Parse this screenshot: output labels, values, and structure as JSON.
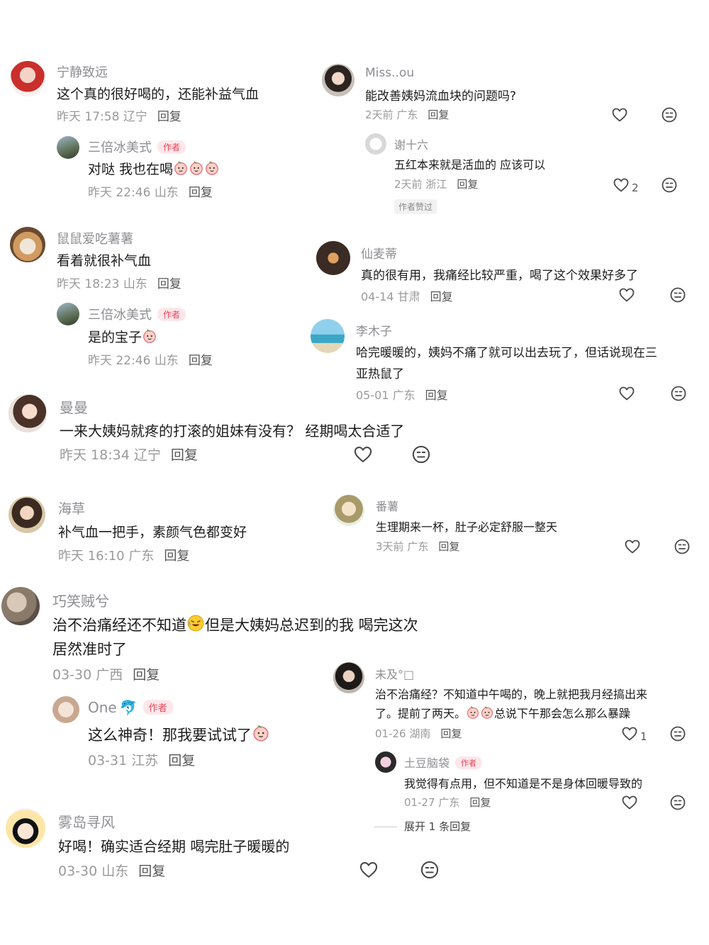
{
  "author_badge": "作者",
  "reply_label": "回复",
  "left": [
    {
      "name": "宁静致远",
      "text": "这个真的很好喝的，还能补益气血",
      "date": "昨天 17:58",
      "loc": "辽宁"
    },
    {
      "name": "三倍冰美式",
      "text": "对哒 我也在喝",
      "date": "昨天 22:46",
      "loc": "山东"
    },
    {
      "name": "鼠鼠爱吃薯薯",
      "text": "看着就很补气血",
      "date": "昨天 18:23",
      "loc": "山东"
    },
    {
      "name": "三倍冰美式",
      "text": "是的宝子",
      "date": "昨天 22:46",
      "loc": "山东"
    },
    {
      "name": "曼曼",
      "text": "一来大姨妈就疼的打滚的姐妹有没有？ 经期喝太合适了",
      "date": "昨天 18:34",
      "loc": "辽宁"
    },
    {
      "name": "海草",
      "text": "补气血一把手，素颜气色都变好",
      "date": "昨天 16:10",
      "loc": "广东"
    },
    {
      "name": "巧笑贼兮",
      "text1": "治不治痛经还不知道",
      "text2": "但是大姨妈总迟到的我  喝完这次",
      "text3": "居然准时了",
      "date": "03-30",
      "loc": "广西"
    },
    {
      "name": "One",
      "text": "这么神奇！那我要试试了",
      "date": "03-31",
      "loc": "江苏"
    },
    {
      "name": "雾岛寻风",
      "text": "好喝！确实适合经期 喝完肚子暖暖的",
      "date": "03-30",
      "loc": "山东"
    }
  ],
  "right": [
    {
      "name": "Miss..ou",
      "text": "能改善姨妈流血块的问题吗?",
      "date": "2天前",
      "loc": "广东"
    },
    {
      "name": "谢十六",
      "text": "五红本来就是活血的 应该可以",
      "date": "2天前",
      "loc": "浙江",
      "likes": "2",
      "tag": "作者赞过"
    },
    {
      "name": "仙麦蒂",
      "text": "真的很有用，我痛经比较严重，喝了这个效果好多了",
      "date": "04-14",
      "loc": "甘肃"
    },
    {
      "name": "李木子",
      "text1": "哈完暖暖的，姨妈不痛了就可以出去玩了，但话说现在三",
      "text2": "亚热鼠了",
      "date": "05-01",
      "loc": "广东"
    },
    {
      "name": "番薯",
      "text": "生理期来一杯，肚子必定舒服一整天",
      "date": "3天前",
      "loc": "广东"
    },
    {
      "name": "未及°□",
      "text1": "治不治痛经？不知道中午喝的，晚上就把我月经搞出来",
      "text2": "了。提前了两天。",
      "text3": "总说下午那会怎么那么暴躁",
      "date": "01-26",
      "loc": "湖南",
      "likes": "1"
    },
    {
      "name": "土豆脑袋",
      "text": "我觉得有点用，但不知道是不是身体回暖导致的",
      "date": "01-27",
      "loc": "广东"
    },
    {
      "expand": "展开 1 条回复"
    }
  ],
  "icon_color": "#4a4a4a",
  "badge_color": "#e8455a"
}
